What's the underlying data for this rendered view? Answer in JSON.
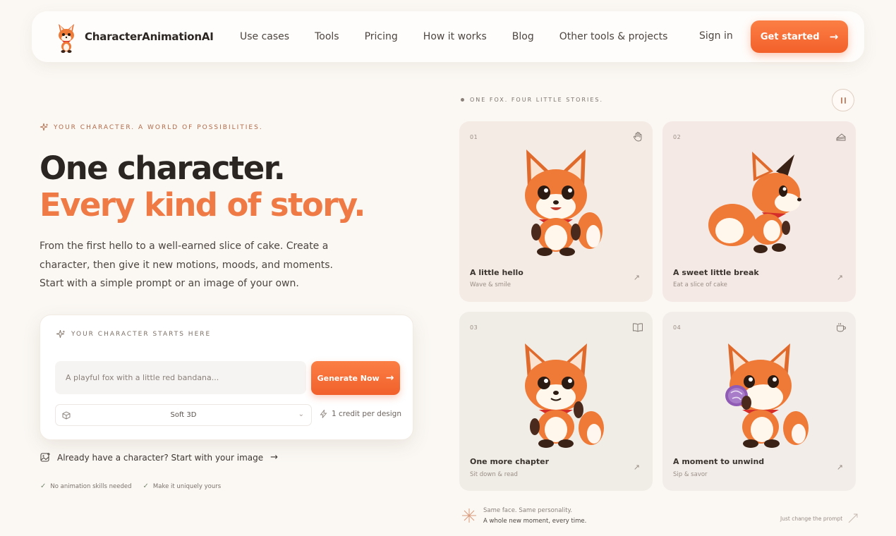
{
  "nav": {
    "brand": "CharacterAnimationAI",
    "links": [
      "Use cases",
      "Tools",
      "Pricing",
      "How it works",
      "Blog",
      "Other tools & projects"
    ],
    "sign_in": "Sign in",
    "cta": "Get started"
  },
  "hero": {
    "eyebrow": "YOUR CHARACTER. A WORLD OF POSSIBILITIES.",
    "title_line1": "One character.",
    "title_line2": "Every kind of story.",
    "lead": "From the first hello to a well-earned slice of cake. Create a character, then give it new motions, moods, and moments. Start with a simple prompt or an image of your own."
  },
  "creator": {
    "eyebrow": "YOUR CHARACTER STARTS HERE",
    "prompt_placeholder": "A playful fox with a little red bandana...",
    "generate": "Generate Now",
    "style": "Soft 3D",
    "credit": "1 credit per design"
  },
  "upload": {
    "label": "Already have a character? Start with your image"
  },
  "checks": [
    "No animation skills needed",
    "Make it uniquely yours"
  ],
  "showcase": {
    "eyebrow": "ONE FOX. FOUR LITTLE STORIES.",
    "tiles": [
      {
        "num": "01",
        "title": "A little hello",
        "sub": "Wave & smile",
        "icon": "hand-icon",
        "bg": "#f4ebe4"
      },
      {
        "num": "02",
        "title": "A sweet little break",
        "sub": "Eat a slice of cake",
        "icon": "cake-icon",
        "bg": "#f5e9e5"
      },
      {
        "num": "03",
        "title": "One more chapter",
        "sub": "Sit down & read",
        "icon": "book-icon",
        "bg": "#efede6"
      },
      {
        "num": "04",
        "title": "A moment to unwind",
        "sub": "Sip & savor",
        "icon": "cup-icon",
        "bg": "#f2ede9"
      }
    ],
    "footer_line1": "Same face. Same personality.",
    "footer_line2": "A whole new moment, every time.",
    "footer_right": "Just change the prompt"
  },
  "colors": {
    "accent": "#f3692f",
    "accent_text": "#f07a45",
    "background": "#fbf8f4"
  }
}
